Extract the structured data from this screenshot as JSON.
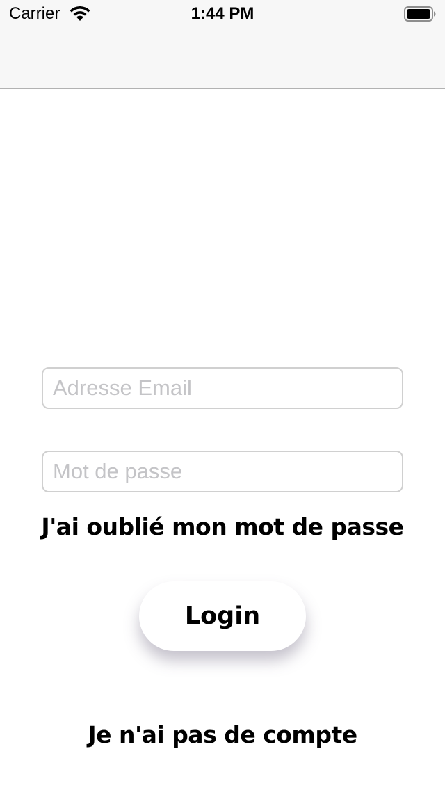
{
  "status_bar": {
    "carrier": "Carrier",
    "time": "1:44 PM",
    "wifi_icon": "wifi-icon",
    "battery_icon": "battery-full-icon"
  },
  "login_form": {
    "email": {
      "value": "",
      "placeholder": "Adresse Email"
    },
    "password": {
      "value": "",
      "placeholder": "Mot de passe"
    },
    "forgot_password_label": "J'ai oublié mon mot de passe",
    "login_label": "Login",
    "no_account_label": "Je n'ai pas de compte"
  },
  "colors": {
    "background": "#ffffff",
    "nav_bar": "#f7f7f7",
    "field_border": "#d0d0d0",
    "placeholder": "#c4c4c7",
    "text": "#000000"
  }
}
